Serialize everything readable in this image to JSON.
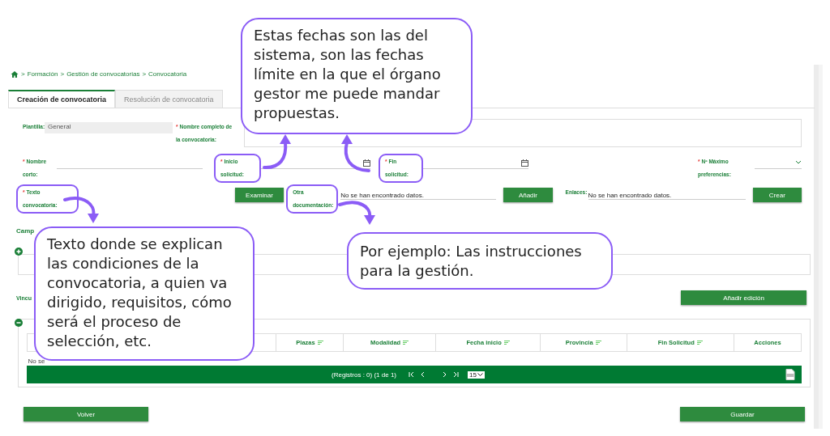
{
  "breadcrumb": [
    {
      "separator": ">",
      "label": "Formación"
    },
    {
      "separator": ">",
      "label": "Gestión de convocatorias"
    },
    {
      "separator": ">",
      "label": "Convocatoria"
    }
  ],
  "tabs": [
    {
      "label": "Creación de convocatoria",
      "selected": true
    },
    {
      "label": "Resolución de convocatoria",
      "selected": false
    }
  ],
  "form_rows": [
    [
      {
        "kind": "readonly",
        "label": "Plantilla:",
        "value": "General",
        "highlighted": false
      },
      {
        "kind": "textarea",
        "mark": "*",
        "label": "Nombre completo de la convocatoria:",
        "highlighted": false
      }
    ],
    [
      {
        "kind": "text",
        "mark": "*",
        "label": "Nombre corto:",
        "highlighted": false
      },
      {
        "kind": "date",
        "mark": "*",
        "label": "Inicio solicitud:",
        "highlighted": true
      },
      {
        "kind": "date",
        "mark": "*",
        "label": "Fin solicitud:",
        "highlighted": true
      },
      {
        "kind": "select",
        "mark": "*",
        "label": "Nº Máximo preferencias:",
        "highlighted": false
      }
    ],
    [
      {
        "kind": "file",
        "mark": "*",
        "label": "Texto convocatoria:",
        "button": "Examinar",
        "highlighted": true
      },
      {
        "kind": "list",
        "label": "Otra documentación:",
        "value": "No se han encontrado datos.",
        "button": "Añadir",
        "highlighted": true
      },
      {
        "kind": "list",
        "label": "Enlaces:",
        "value": "No se han encontrado datos.",
        "button": "Crear",
        "highlighted": false
      }
    ]
  ],
  "campo_section": {
    "label": "Camp",
    "expanded": false
  },
  "vinculo_section": {
    "label": "Vincu",
    "button": "Añadir edición"
  },
  "table": {
    "expanded": true,
    "columns": [
      "Plazas",
      "Modalidad",
      "Fecha inicio",
      "Provincia",
      "Fin Solicitud",
      "Acciones"
    ],
    "sortable": [
      true,
      true,
      true,
      true,
      true,
      false
    ],
    "empty_text": "No se",
    "pager": {
      "records": "(Registros : 0) (1 de 1)",
      "page_size": "15"
    }
  },
  "buttons": [
    "Volver",
    "Guardar"
  ],
  "callouts": [
    {
      "text": "Estas fechas son las del sistema, son las fechas límite en la que el órgano gestor me puede mandar propuestas."
    },
    {
      "text": "Texto donde se explican las condiciones de la convocatoria, a quien va dirigido, requisitos, cómo será el proceso de selección, etc."
    },
    {
      "text": "Por ejemplo: Las instrucciones para la gestión."
    }
  ]
}
